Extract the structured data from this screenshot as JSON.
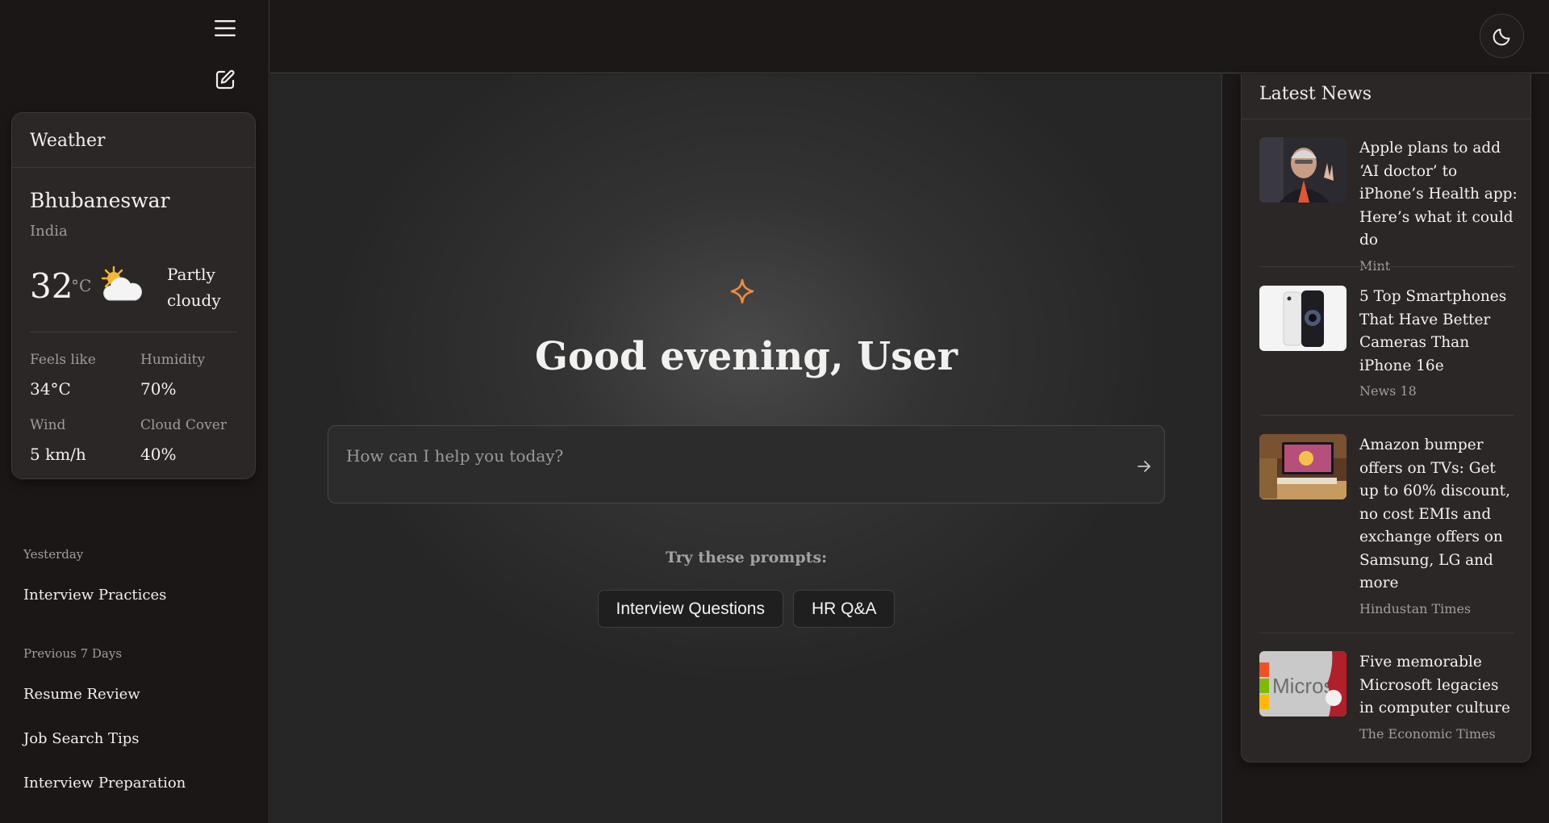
{
  "sidebar": {
    "weather": {
      "title": "Weather",
      "city": "Bhubaneswar",
      "country": "India",
      "temperature": "32",
      "unit": "°C",
      "condition": "Partly cloudy",
      "icon": "partly-cloudy-icon",
      "feels_like_label": "Feels like",
      "feels_like_value": "34°C",
      "humidity_label": "Humidity",
      "humidity_value": "70%",
      "wind_label": "Wind",
      "wind_value": "5 km/h",
      "cloud_cover_label": "Cloud Cover",
      "cloud_cover_value": "40%"
    },
    "history": {
      "yesterday_label": "Yesterday",
      "yesterday_items": [
        "Interview Practices"
      ],
      "previous_label": "Previous 7 Days",
      "previous_items": [
        "Resume Review",
        "Job Search Tips",
        "Interview Preparation"
      ]
    }
  },
  "main": {
    "greeting": "Good evening, User",
    "input_placeholder": "How can I help you today?",
    "try_label": "Try these prompts:",
    "prompts": [
      "Interview Questions",
      "HR Q&A"
    ]
  },
  "news": {
    "title": "Latest News",
    "items": [
      {
        "title": "Apple plans to add ‘AI doctor’ to iPhone’s Health app: Here’s what it could do",
        "source": "Mint"
      },
      {
        "title": "5 Top Smartphones That Have Better Cameras Than iPhone 16e",
        "source": "News 18"
      },
      {
        "title": "Amazon bumper offers on TVs: Get up to 60% discount, no cost EMIs and exchange offers on Samsung, LG and more",
        "source": "Hindustan Times"
      },
      {
        "title": "Five memorable Microsoft legacies in computer culture",
        "source": "The Economic Times"
      }
    ]
  },
  "colors": {
    "accent": "#f08a3c",
    "background": "#1c1817",
    "card": "#2a2726"
  }
}
